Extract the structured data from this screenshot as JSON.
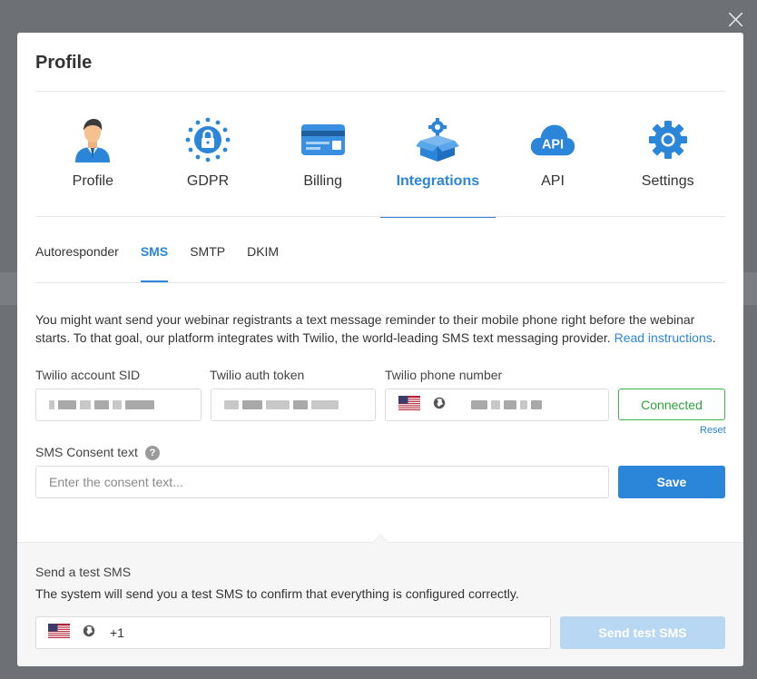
{
  "close_label": "×",
  "modal_title": "Profile",
  "main_tabs": [
    {
      "label": "Profile",
      "icon": "user-avatar-icon"
    },
    {
      "label": "GDPR",
      "icon": "gdpr-lock-icon"
    },
    {
      "label": "Billing",
      "icon": "credit-card-icon"
    },
    {
      "label": "Integrations",
      "icon": "integrations-box-icon",
      "active": true
    },
    {
      "label": "API",
      "icon": "api-cloud-icon"
    },
    {
      "label": "Settings",
      "icon": "gear-icon"
    }
  ],
  "sub_tabs": [
    {
      "label": "Autoresponder"
    },
    {
      "label": "SMS",
      "active": true
    },
    {
      "label": "SMTP"
    },
    {
      "label": "DKIM"
    }
  ],
  "description": {
    "text": "You might want send your webinar registrants a text message reminder to their mobile phone right before the webinar starts. To that goal, our platform integrates with Twilio, the world-leading SMS text messaging provider.",
    "link": "Read instructions",
    "suffix": "."
  },
  "fields": {
    "account_sid_label": "Twilio account SID",
    "auth_token_label": "Twilio auth token",
    "phone_number_label": "Twilio phone number",
    "connected_label": "Connected",
    "reset_label": "Reset",
    "consent_label": "SMS Consent text",
    "consent_help": "?",
    "consent_placeholder": "Enter the consent text...",
    "save_label": "Save"
  },
  "test_sms": {
    "title": "Send a test SMS",
    "description": "The system will send you a test SMS to confirm that everything is configured correctly.",
    "prefix": "+1",
    "send_label": "Send test SMS"
  },
  "colors": {
    "accent": "#2b86d9",
    "connected": "#2ea43c",
    "send_disabled": "#b7d7f3"
  }
}
